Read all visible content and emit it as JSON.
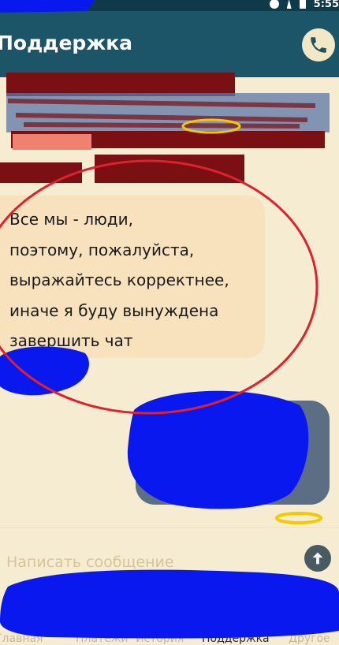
{
  "header": {
    "title": "Поддержка",
    "call_icon": "phone-icon"
  },
  "status_bar": {
    "time": "5:55"
  },
  "messages": [
    {
      "sender": "support",
      "text": "Все мы - люди,\nпоэтому, пожалуйста,\nвыражайтесь корректнее,\nиначе я буду вынуждена\nзавершить чат"
    }
  ],
  "input": {
    "placeholder": "Написать сообщение"
  },
  "send_icon": "arrow-up-icon",
  "bottom_nav": {
    "items": [
      "Главная",
      "Платежи",
      "История",
      "Поддержка",
      "Другое"
    ],
    "active": "Поддержка"
  },
  "colors": {
    "header_bg": "#1c5468",
    "chat_bg": "#f6ecd2",
    "support_bubble": "#f8e1bd",
    "user_bubble": "#5b6e84",
    "annotation_red": "#e0202a",
    "scribble_blue": "#0a18f0"
  }
}
